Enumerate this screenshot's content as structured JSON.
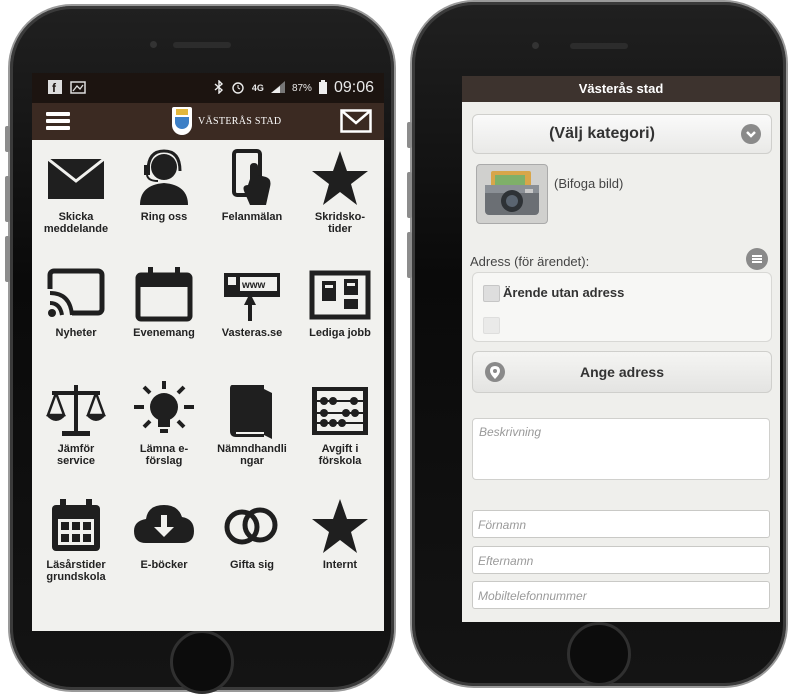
{
  "left_phone": {
    "status_bar": {
      "icons": [
        "facebook-icon",
        "gallery-icon",
        "bluetooth-icon",
        "alarm-icon",
        "4g-icon",
        "signal-icon",
        "battery-icon"
      ],
      "network": "4G",
      "battery": "87%",
      "time": "09:06"
    },
    "header": {
      "brand": "VÄSTERÅS STAD"
    },
    "tiles": [
      {
        "label": "Skicka meddelande",
        "icon": "envelope-icon"
      },
      {
        "label": "Ring oss",
        "icon": "headset-person-icon"
      },
      {
        "label": "Felanmälan",
        "icon": "phone-tap-icon"
      },
      {
        "label": "Skridsko-tider",
        "icon": "star-icon"
      },
      {
        "label": "Nyheter",
        "icon": "cast-icon"
      },
      {
        "label": "Evenemang",
        "icon": "calendar-icon"
      },
      {
        "label": "Vasteras.se",
        "icon": "www-cursor-icon"
      },
      {
        "label": "Lediga jobb",
        "icon": "job-board-icon"
      },
      {
        "label": "Jämför service",
        "icon": "scales-icon"
      },
      {
        "label": "Lämna e-förslag",
        "icon": "lightbulb-icon"
      },
      {
        "label": "Nämndhandlingar",
        "icon": "book-icon"
      },
      {
        "label": "Avgift i förskola",
        "icon": "abacus-icon"
      },
      {
        "label": "Läsårstider grundskola",
        "icon": "calendar-grid-icon"
      },
      {
        "label": "E-böcker",
        "icon": "cloud-download-icon"
      },
      {
        "label": "Gifta sig",
        "icon": "rings-icon"
      },
      {
        "label": "Internt",
        "icon": "star-icon"
      }
    ],
    "tile_labels_display": [
      [
        "Skicka",
        "meddelande"
      ],
      [
        "Ring oss"
      ],
      [
        "Felanmälan"
      ],
      [
        "Skridsko-",
        "tider"
      ],
      [
        "Nyheter"
      ],
      [
        "Evenemang"
      ],
      [
        "Vasteras.se"
      ],
      [
        "Lediga jobb"
      ],
      [
        "Jämför",
        "service"
      ],
      [
        "Lämna e-",
        "förslag"
      ],
      [
        "Nämndhandli",
        "ngar"
      ],
      [
        "Avgift i",
        "förskola"
      ],
      [
        "Läsårstider",
        "grundskola"
      ],
      [
        "E-böcker"
      ],
      [
        "Gifta sig"
      ],
      [
        "Internt"
      ]
    ],
    "colors": {
      "header_bg": "#3b2a22",
      "icon": "#1f1f1f"
    }
  },
  "right_phone": {
    "title": "Västerås stad",
    "category_select": "(Välj kategori)",
    "attach_image": "(Bifoga bild)",
    "address_label": "Adress (för ärendet):",
    "no_address_checkbox": "Ärende utan adress",
    "set_address_button": "Ange adress",
    "description_placeholder": "Beskrivning",
    "fields": [
      {
        "placeholder": "Förnamn"
      },
      {
        "placeholder": "Efternamn"
      },
      {
        "placeholder": "Mobiltelefonnummer"
      }
    ]
  }
}
